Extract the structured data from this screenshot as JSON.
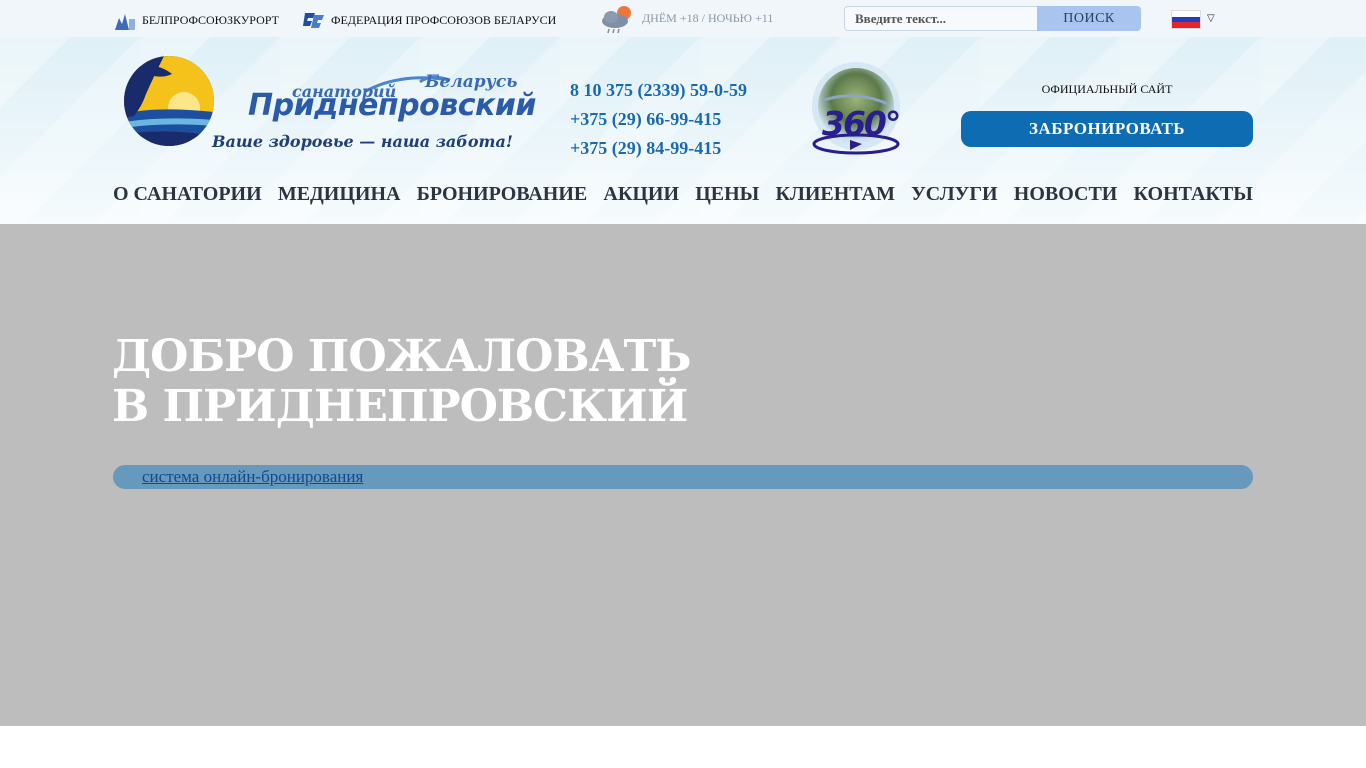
{
  "topbar": {
    "links": [
      {
        "label": "БЕЛПРОФСОЮЗКУРОРТ",
        "icon": "belprofsoyuzkurort-logo-icon"
      },
      {
        "label": "ФЕДЕРАЦИЯ ПРОФСОЮЗОВ БЕЛАРУСИ",
        "icon": "fpb-logo-icon"
      }
    ],
    "weather": {
      "icon": "cloud-rain-sun-icon",
      "text": "ДНЁМ +18 / НОЧЬЮ +11"
    },
    "search": {
      "placeholder": "Введите текст...",
      "button_label": "ПОИСК"
    },
    "language": {
      "icon": "russia-flag-icon",
      "flag_colors": [
        "#ffffff",
        "#1f3fbf",
        "#e3262b"
      ]
    }
  },
  "header": {
    "logo": {
      "small_top": "санаторий",
      "country": "Беларусь",
      "name": "Приднепровский",
      "slogan": "Ваше здоровье — наша забота!"
    },
    "phones": [
      "8 10 375 (2339) 59-0-59",
      "+375 (29) 66-99-415",
      "+375 (29) 84-99-415"
    ],
    "panorama": {
      "label": "360°",
      "icon": "panorama-360-icon"
    },
    "official_label": "ОФИЦИАЛЬНЫЙ САЙТ",
    "book_button": "ЗАБРОНИРОВАТЬ"
  },
  "nav": {
    "items": [
      "О САНАТОРИИ",
      "МЕДИЦИНА",
      "БРОНИРОВАНИЕ",
      "АКЦИИ",
      "ЦЕНЫ",
      "КЛИЕНТАМ",
      "УСЛУГИ",
      "НОВОСТИ",
      "КОНТАКТЫ"
    ]
  },
  "hero": {
    "title_line1": "ДОБРО ПОЖАЛОВАТЬ",
    "title_line2": "В ПРИДНЕПРОВСКИЙ",
    "booking_link": "система онлайн-бронирования"
  },
  "colors": {
    "accent": "#0e6cb3",
    "phone": "#1969b1",
    "hero_bg": "#bdbdbd",
    "booking_bar": "#6699bb"
  }
}
